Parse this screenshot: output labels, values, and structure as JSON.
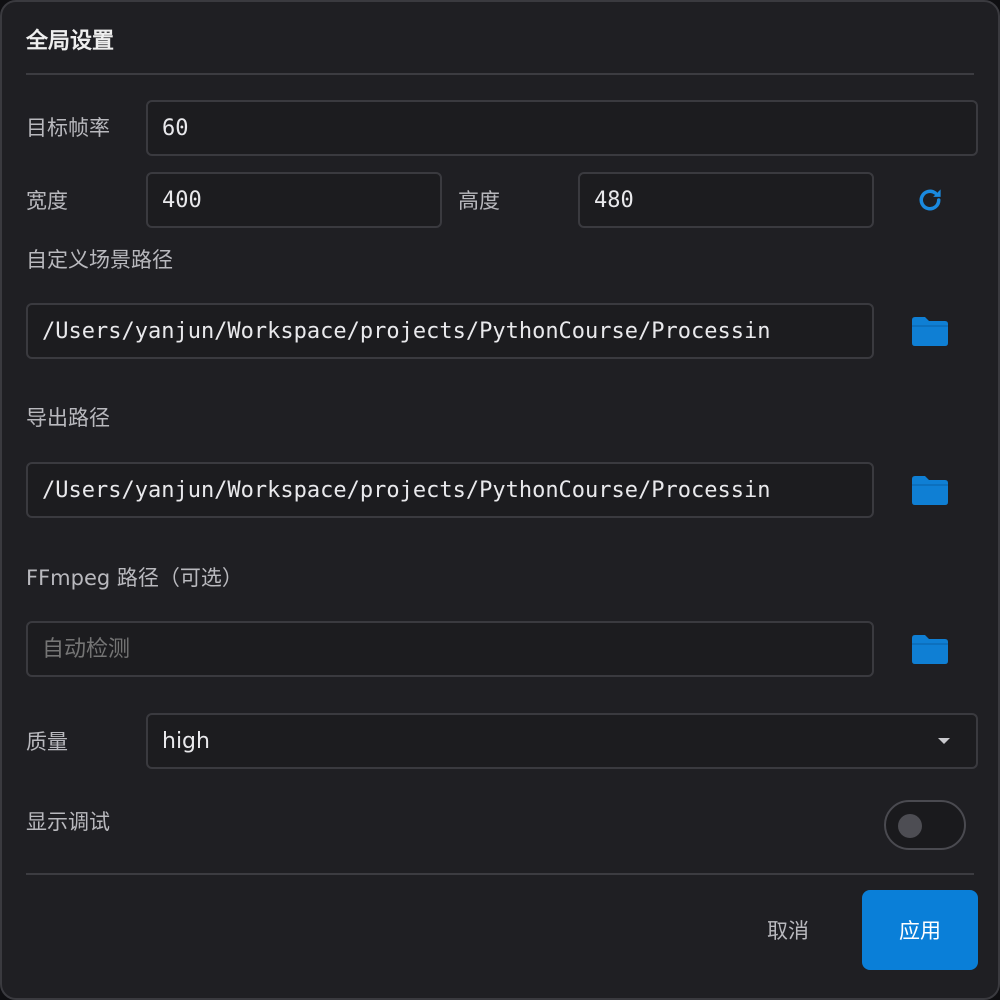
{
  "dialog": {
    "title": "全局设置"
  },
  "fields": {
    "fps": {
      "label": "目标帧率",
      "value": "60"
    },
    "width": {
      "label": "宽度",
      "value": "400"
    },
    "height": {
      "label": "高度",
      "value": "480"
    },
    "scene_path": {
      "label": "自定义场景路径",
      "value": "/Users/yanjun/Workspace/projects/PythonCourse/Processin"
    },
    "export_path": {
      "label": "导出路径",
      "value": "/Users/yanjun/Workspace/projects/PythonCourse/Processin"
    },
    "ffmpeg_path": {
      "label": "FFmpeg 路径（可选）",
      "value": "",
      "placeholder": "自动检测"
    },
    "quality": {
      "label": "质量",
      "selected": "high"
    },
    "debug": {
      "label": "显示调试",
      "on": false
    }
  },
  "icons": {
    "reset": "refresh-icon",
    "browse": "folder-icon"
  },
  "buttons": {
    "cancel": "取消",
    "apply": "应用"
  },
  "colors": {
    "accent": "#0a7fd8",
    "background": "#1f1f23",
    "field_border": "#3a3a3f"
  }
}
